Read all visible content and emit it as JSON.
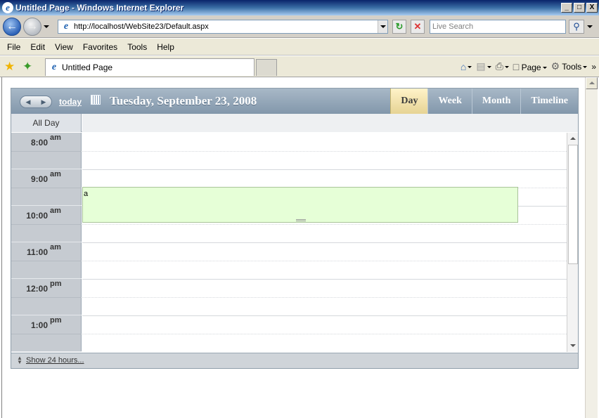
{
  "window": {
    "title": "Untitled Page - Windows Internet Explorer",
    "buttons": [
      "_",
      "□",
      "X"
    ]
  },
  "address_bar": {
    "url": "http://localhost/WebSite23/Default.aspx",
    "search_placeholder": "Live Search"
  },
  "menu": [
    "File",
    "Edit",
    "View",
    "Favorites",
    "Tools",
    "Help"
  ],
  "tab": {
    "label": "Untitled Page"
  },
  "command_bar": {
    "page_label": "Page",
    "tools_label": "Tools",
    "more": "»"
  },
  "scheduler": {
    "today_label": "today",
    "date_title": "Tuesday, September 23, 2008",
    "views": [
      "Day",
      "Week",
      "Month",
      "Timeline"
    ],
    "active_view": "Day",
    "all_day_label": "All Day",
    "hours": [
      {
        "h": "8:00",
        "ampm": "am"
      },
      {
        "h": "9:00",
        "ampm": "am"
      },
      {
        "h": "10:00",
        "ampm": "am"
      },
      {
        "h": "11:00",
        "ampm": "am"
      },
      {
        "h": "12:00",
        "ampm": "pm"
      },
      {
        "h": "1:00",
        "ampm": "pm"
      }
    ],
    "appointment": {
      "subject": "a",
      "color": "#e6ffd7"
    },
    "footer_link": "Show 24 hours..."
  }
}
